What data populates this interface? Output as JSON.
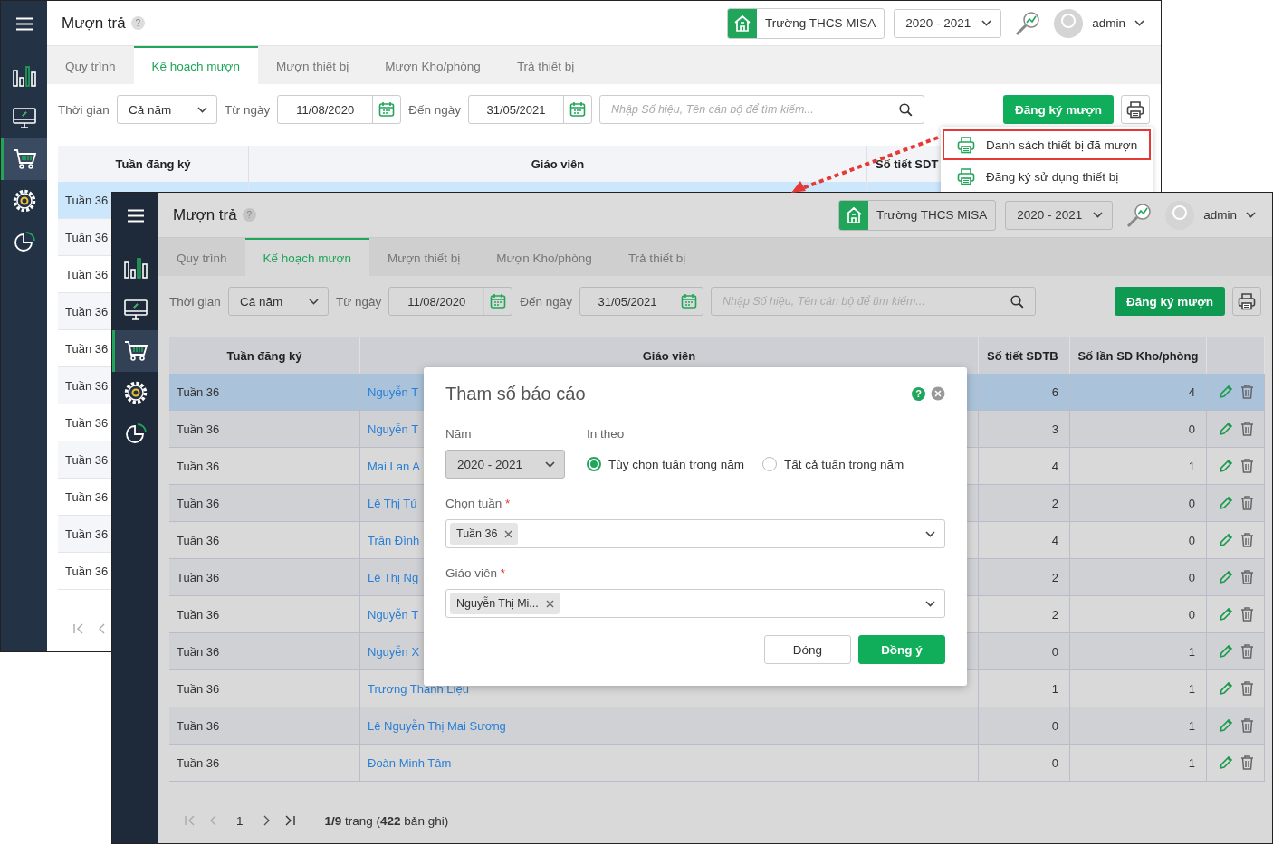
{
  "windows": [
    {
      "dimmed": false,
      "header": {
        "title": "Mượn trả",
        "help": "?",
        "school": "Trường THCS MISA",
        "year": "2020 - 2021",
        "user": "admin"
      },
      "sidebar": [
        {
          "kind": "menu",
          "selected": false
        },
        {
          "kind": "chart",
          "selected": false
        },
        {
          "kind": "monitor",
          "selected": false
        },
        {
          "kind": "cart",
          "selected": true
        },
        {
          "kind": "gear",
          "selected": false
        },
        {
          "kind": "pie",
          "selected": false
        }
      ],
      "tabs": [
        {
          "label": "Quy trình",
          "selected": false
        },
        {
          "label": "Kế hoạch mượn",
          "selected": true
        },
        {
          "label": "Mượn thiết bị",
          "selected": false
        },
        {
          "label": "Mượn Kho/phòng",
          "selected": false
        },
        {
          "label": "Trả thiết bị",
          "selected": false
        }
      ],
      "filters": {
        "period_label": "Thời gian",
        "period": "Cả năm",
        "from_label": "Từ ngày",
        "from": "11/08/2020",
        "to_label": "Đến ngày",
        "to": "31/05/2021",
        "search_placeholder": "Nhập Số hiệu, Tên cán bộ để tìm kiếm...",
        "register_button": "Đăng ký mượn"
      },
      "print_menu": [
        {
          "label": "Danh sách thiết bị đã mượn",
          "highlighted": true
        },
        {
          "label": "Đăng ký sử dụng thiết bị",
          "highlighted": false
        }
      ],
      "table": {
        "columns": [
          "Tuần đăng ký",
          "Giáo viên",
          "Số tiết SDT"
        ],
        "rows": [
          {
            "week": "Tuần 36",
            "selected": true
          },
          {
            "week": "Tuần 36",
            "selected": false
          },
          {
            "week": "Tuần 36",
            "selected": false
          },
          {
            "week": "Tuần 36",
            "selected": false
          },
          {
            "week": "Tuần 36",
            "selected": false
          },
          {
            "week": "Tuần 36",
            "selected": false
          },
          {
            "week": "Tuần 36",
            "selected": false
          },
          {
            "week": "Tuần 36",
            "selected": false
          },
          {
            "week": "Tuần 36",
            "selected": false
          },
          {
            "week": "Tuần 36",
            "selected": false
          },
          {
            "week": "Tuần 36",
            "selected": false
          }
        ]
      }
    },
    {
      "dimmed": true,
      "header": {
        "title": "Mượn trả",
        "help": "?",
        "school": "Trường THCS MISA",
        "year": "2020 - 2021",
        "user": "admin"
      },
      "sidebar": [
        {
          "kind": "menu",
          "selected": false
        },
        {
          "kind": "chart",
          "selected": false
        },
        {
          "kind": "monitor",
          "selected": false
        },
        {
          "kind": "cart",
          "selected": true
        },
        {
          "kind": "gear",
          "selected": false
        },
        {
          "kind": "pie",
          "selected": false
        }
      ],
      "tabs": [
        {
          "label": "Quy trình",
          "selected": false
        },
        {
          "label": "Kế hoạch mượn",
          "selected": true
        },
        {
          "label": "Mượn thiết bị",
          "selected": false
        },
        {
          "label": "Mượn Kho/phòng",
          "selected": false
        },
        {
          "label": "Trả thiết bị",
          "selected": false
        }
      ],
      "filters": {
        "period_label": "Thời gian",
        "period": "Cả năm",
        "from_label": "Từ ngày",
        "from": "11/08/2020",
        "to_label": "Đến ngày",
        "to": "31/05/2021",
        "search_placeholder": "Nhập Số hiệu, Tên cán bộ để tìm kiếm...",
        "register_button": "Đăng ký mượn"
      },
      "table": {
        "columns": [
          "Tuần đăng ký",
          "Giáo viên",
          "Số tiết SDTB",
          "Số lần SD Kho/phòng"
        ],
        "rows": [
          {
            "week": "Tuần 36",
            "teacher": "Nguyễn T",
            "periods": "6",
            "room_uses": "4",
            "selected": true
          },
          {
            "week": "Tuần 36",
            "teacher": "Nguyễn T",
            "periods": "3",
            "room_uses": "0",
            "selected": false
          },
          {
            "week": "Tuần 36",
            "teacher": "Mai Lan A",
            "periods": "4",
            "room_uses": "1",
            "selected": false
          },
          {
            "week": "Tuần 36",
            "teacher": "Lê Thị Tú",
            "periods": "2",
            "room_uses": "0",
            "selected": false
          },
          {
            "week": "Tuần 36",
            "teacher": "Trần Đình",
            "periods": "4",
            "room_uses": "0",
            "selected": false
          },
          {
            "week": "Tuần 36",
            "teacher": "Lê Thị Ng",
            "periods": "2",
            "room_uses": "0",
            "selected": false
          },
          {
            "week": "Tuần 36",
            "teacher": "Nguyễn T",
            "periods": "2",
            "room_uses": "0",
            "selected": false
          },
          {
            "week": "Tuần 36",
            "teacher": "Nguyễn X",
            "periods": "0",
            "room_uses": "1",
            "selected": false
          },
          {
            "week": "Tuần 36",
            "teacher": "Trương Thanh Liệu",
            "periods": "1",
            "room_uses": "1",
            "selected": false
          },
          {
            "week": "Tuần 36",
            "teacher": "Lê Nguyễn Thị Mai Sương",
            "periods": "0",
            "room_uses": "1",
            "selected": false
          },
          {
            "week": "Tuần 36",
            "teacher": "Đoàn Minh Tâm",
            "periods": "0",
            "room_uses": "1",
            "selected": false
          }
        ]
      },
      "pagination": {
        "page": "1",
        "info": "**1/9** trang (**422** bản ghi)"
      },
      "dialog": {
        "title": "Tham số báo cáo",
        "help": "?",
        "year_label": "Năm",
        "year": "2020 - 2021",
        "print_by_label": "In theo",
        "options": [
          {
            "label": "Tùy chọn tuần trong năm",
            "selected": true
          },
          {
            "label": "Tất cả tuần trong năm",
            "selected": false
          }
        ],
        "fields": [
          {
            "label": "Chọn tuần",
            "mark": "*",
            "tags": [
              "Tuần 36"
            ]
          },
          {
            "label": "Giáo viên",
            "mark": "*",
            "tags": [
              "Nguyễn Thị Mi..."
            ]
          }
        ],
        "cancel_button": "Đóng",
        "ok_button": "Đồng ý"
      }
    }
  ]
}
